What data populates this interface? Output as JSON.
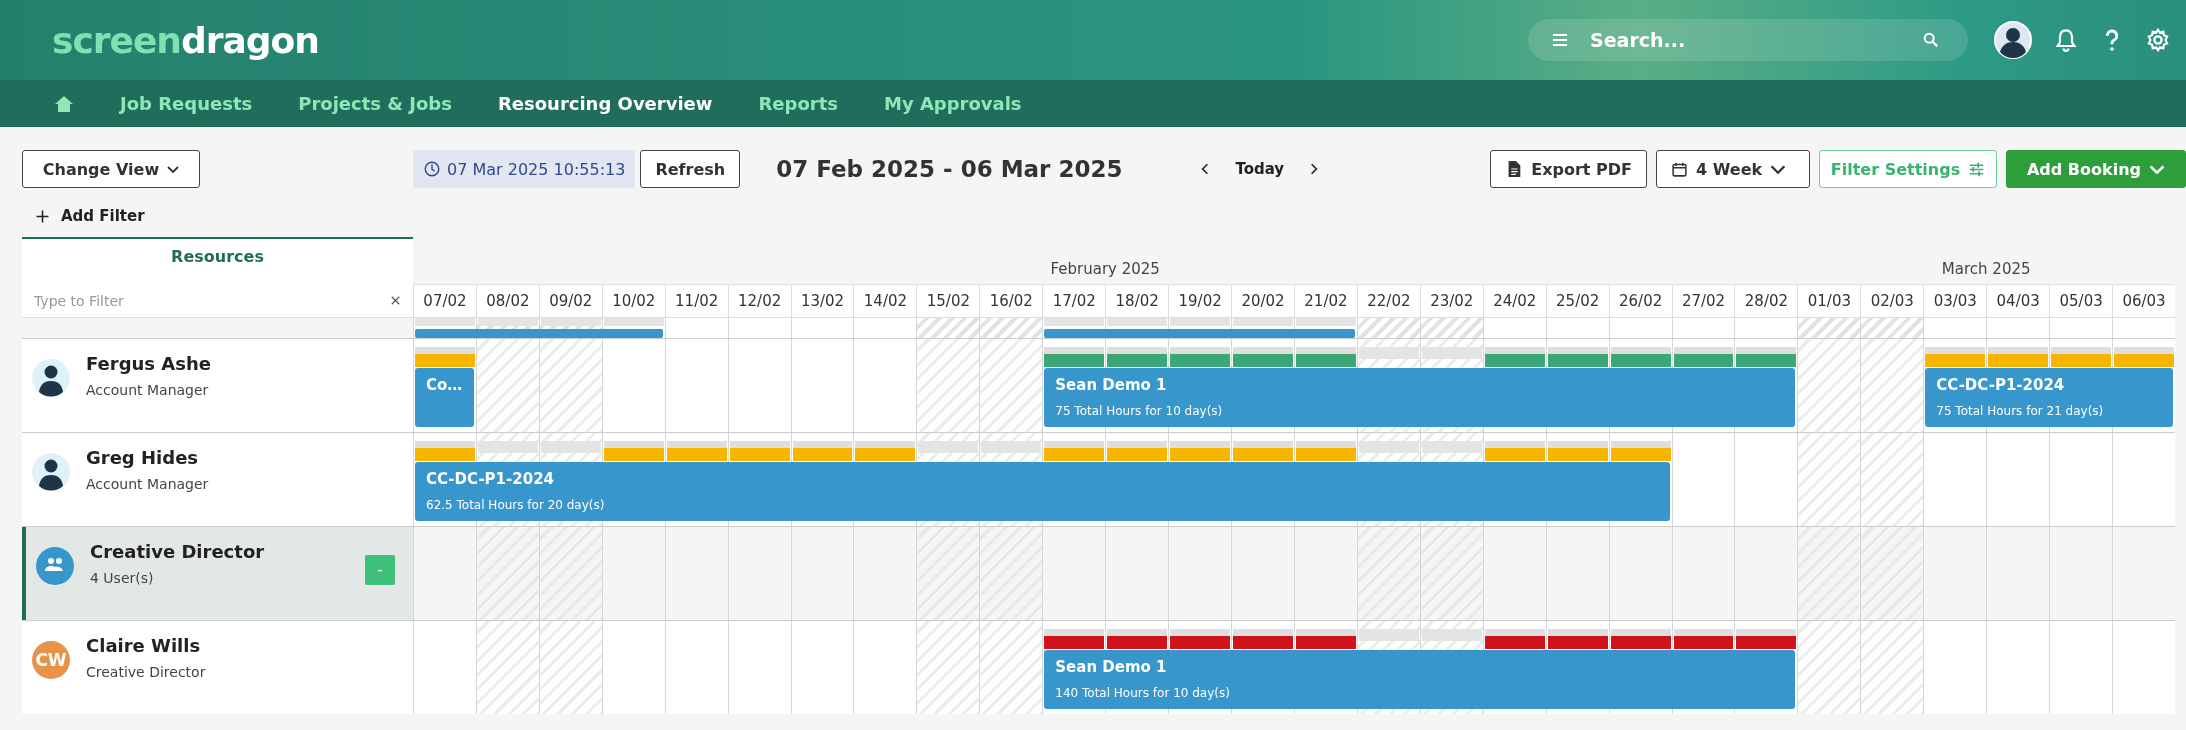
{
  "header": {
    "logo": {
      "light": "screen",
      "bold": "dragon"
    },
    "search": {
      "placeholder": "Search..."
    }
  },
  "nav": {
    "items": [
      {
        "kind": "home",
        "selected": false
      },
      {
        "label": "Job Requests",
        "selected": false
      },
      {
        "label": "Projects & Jobs",
        "selected": false
      },
      {
        "label": "Resourcing Overview",
        "selected": true
      },
      {
        "label": "Reports",
        "selected": false
      },
      {
        "label": "My Approvals",
        "selected": false
      }
    ]
  },
  "toolbar": {
    "change_view": "Change View",
    "timestamp": "07 Mar 2025 10:55:13",
    "refresh": "Refresh",
    "range": "07 Feb 2025 - 06 Mar 2025",
    "today": "Today",
    "export": "Export PDF",
    "period": "4 Week",
    "filter_settings": "Filter Settings",
    "add_booking": "Add Booking",
    "add_filter": "Add Filter"
  },
  "resources": {
    "title": "Resources",
    "filter_placeholder": "Type to Filter"
  },
  "months": [
    {
      "label": "February 2025",
      "days": [
        {
          "label": "07/02",
          "weekend": false
        },
        {
          "label": "08/02",
          "weekend": true
        },
        {
          "label": "09/02",
          "weekend": true
        },
        {
          "label": "10/02",
          "weekend": false
        },
        {
          "label": "11/02",
          "weekend": false
        },
        {
          "label": "12/02",
          "weekend": false
        },
        {
          "label": "13/02",
          "weekend": false
        },
        {
          "label": "14/02",
          "weekend": false
        },
        {
          "label": "15/02",
          "weekend": true
        },
        {
          "label": "16/02",
          "weekend": true
        },
        {
          "label": "17/02",
          "weekend": false
        },
        {
          "label": "18/02",
          "weekend": false
        },
        {
          "label": "19/02",
          "weekend": false
        },
        {
          "label": "20/02",
          "weekend": false
        },
        {
          "label": "21/02",
          "weekend": false
        },
        {
          "label": "22/02",
          "weekend": true
        },
        {
          "label": "23/02",
          "weekend": true
        },
        {
          "label": "24/02",
          "weekend": false
        },
        {
          "label": "25/02",
          "weekend": false
        },
        {
          "label": "26/02",
          "weekend": false
        },
        {
          "label": "27/02",
          "weekend": false
        },
        {
          "label": "28/02",
          "weekend": false
        }
      ]
    },
    {
      "label": "March 2025",
      "days": [
        {
          "label": "01/03",
          "weekend": true
        },
        {
          "label": "02/03",
          "weekend": true
        },
        {
          "label": "03/03",
          "weekend": false
        },
        {
          "label": "04/03",
          "weekend": false
        },
        {
          "label": "05/03",
          "weekend": false
        },
        {
          "label": "06/03",
          "weekend": false
        }
      ]
    }
  ],
  "cut_row": {
    "slots": [
      {
        "kind": "booking",
        "days": [
          {
            "kind": "none"
          },
          {
            "kind": "none"
          },
          {
            "kind": "none"
          },
          {
            "kind": "none"
          }
        ]
      },
      {
        "kind": "free"
      },
      {
        "kind": "free"
      },
      {
        "kind": "free"
      },
      {
        "kind": "free"
      },
      {
        "kind": "free"
      },
      {
        "kind": "free"
      },
      {
        "kind": "booking",
        "days": [
          {
            "kind": "none"
          },
          {
            "kind": "none"
          },
          {
            "kind": "none"
          },
          {
            "kind": "none"
          },
          {
            "kind": "none"
          }
        ]
      },
      {
        "kind": "free"
      },
      {
        "kind": "free"
      },
      {
        "kind": "free"
      },
      {
        "kind": "free"
      },
      {
        "kind": "free"
      },
      {
        "kind": "free"
      },
      {
        "kind": "free"
      },
      {
        "kind": "free"
      },
      {
        "kind": "free"
      },
      {
        "kind": "free"
      },
      {
        "kind": "free"
      },
      {
        "kind": "free"
      },
      {
        "kind": "free"
      }
    ]
  },
  "rows": [
    {
      "kind": "person",
      "name": "Fergus Ashe",
      "role": "Account Manager",
      "avatar": {
        "kind": "silhouette"
      },
      "slots": [
        {
          "kind": "booking",
          "title": "Co…",
          "days": [
            {
              "kind": "load",
              "color": "#f7b500"
            }
          ]
        },
        {
          "kind": "free"
        },
        {
          "kind": "free"
        },
        {
          "kind": "free"
        },
        {
          "kind": "free"
        },
        {
          "kind": "free"
        },
        {
          "kind": "free"
        },
        {
          "kind": "free"
        },
        {
          "kind": "free"
        },
        {
          "kind": "free"
        },
        {
          "kind": "booking",
          "title": "Sean Demo 1",
          "hours": "75 Total Hours for 10 day(s)",
          "days": [
            {
              "kind": "load",
              "color": "#3aa874"
            },
            {
              "kind": "load",
              "color": "#3aa874"
            },
            {
              "kind": "load",
              "color": "#3aa874"
            },
            {
              "kind": "load",
              "color": "#3aa874"
            },
            {
              "kind": "load",
              "color": "#3aa874"
            },
            {
              "kind": "none"
            },
            {
              "kind": "none"
            },
            {
              "kind": "load",
              "color": "#3aa874"
            },
            {
              "kind": "load",
              "color": "#3aa874"
            },
            {
              "kind": "load",
              "color": "#3aa874"
            },
            {
              "kind": "load",
              "color": "#3aa874"
            },
            {
              "kind": "load",
              "color": "#3aa874"
            }
          ]
        },
        {
          "kind": "free"
        },
        {
          "kind": "free"
        },
        {
          "kind": "booking",
          "title": "CC-DC-P1-2024",
          "hours": "75 Total Hours for 21 day(s)",
          "days": [
            {
              "kind": "load",
              "color": "#f7b500"
            },
            {
              "kind": "load",
              "color": "#f7b500"
            },
            {
              "kind": "load",
              "color": "#f7b500"
            },
            {
              "kind": "load",
              "color": "#f7b500"
            }
          ]
        }
      ]
    },
    {
      "kind": "person",
      "name": "Greg Hides",
      "role": "Account Manager",
      "avatar": {
        "kind": "silhouette"
      },
      "slots": [
        {
          "kind": "booking",
          "title": "CC-DC-P1-2024",
          "hours": "62.5 Total Hours for 20 day(s)",
          "days": [
            {
              "kind": "load",
              "color": "#f7b500"
            },
            {
              "kind": "none"
            },
            {
              "kind": "none"
            },
            {
              "kind": "load",
              "color": "#f7b500"
            },
            {
              "kind": "load",
              "color": "#f7b500"
            },
            {
              "kind": "load",
              "color": "#f7b500"
            },
            {
              "kind": "load",
              "color": "#f7b500"
            },
            {
              "kind": "load",
              "color": "#f7b500"
            },
            {
              "kind": "none"
            },
            {
              "kind": "none"
            },
            {
              "kind": "load",
              "color": "#f7b500"
            },
            {
              "kind": "load",
              "color": "#f7b500"
            },
            {
              "kind": "load",
              "color": "#f7b500"
            },
            {
              "kind": "load",
              "color": "#f7b500"
            },
            {
              "kind": "load",
              "color": "#f7b500"
            },
            {
              "kind": "none"
            },
            {
              "kind": "none"
            },
            {
              "kind": "load",
              "color": "#f7b500"
            },
            {
              "kind": "load",
              "color": "#f7b500"
            },
            {
              "kind": "load",
              "color": "#f7b500"
            }
          ]
        },
        {
          "kind": "free"
        },
        {
          "kind": "free"
        },
        {
          "kind": "free"
        },
        {
          "kind": "free"
        },
        {
          "kind": "free"
        },
        {
          "kind": "free"
        },
        {
          "kind": "free"
        },
        {
          "kind": "free"
        }
      ]
    },
    {
      "kind": "group",
      "name": "Creative Director",
      "role": "4 User(s)",
      "toggle": "-",
      "expanded": true
    },
    {
      "kind": "person",
      "name": "Claire Wills",
      "role": "Creative Director",
      "avatar": {
        "kind": "initials",
        "text": "CW",
        "color": "#e8924a"
      },
      "slots": [
        {
          "kind": "free"
        },
        {
          "kind": "free"
        },
        {
          "kind": "free"
        },
        {
          "kind": "free"
        },
        {
          "kind": "free"
        },
        {
          "kind": "free"
        },
        {
          "kind": "free"
        },
        {
          "kind": "free"
        },
        {
          "kind": "free"
        },
        {
          "kind": "free"
        },
        {
          "kind": "booking",
          "title": "Sean Demo 1",
          "hours": "140 Total Hours for 10 day(s)",
          "days": [
            {
              "kind": "load",
              "color": "#d0121a"
            },
            {
              "kind": "load",
              "color": "#d0121a"
            },
            {
              "kind": "load",
              "color": "#d0121a"
            },
            {
              "kind": "load",
              "color": "#d0121a"
            },
            {
              "kind": "load",
              "color": "#d0121a"
            },
            {
              "kind": "none"
            },
            {
              "kind": "none"
            },
            {
              "kind": "load",
              "color": "#d0121a"
            },
            {
              "kind": "load",
              "color": "#d0121a"
            },
            {
              "kind": "load",
              "color": "#d0121a"
            },
            {
              "kind": "load",
              "color": "#d0121a"
            },
            {
              "kind": "load",
              "color": "#d0121a"
            }
          ]
        },
        {
          "kind": "free"
        },
        {
          "kind": "free"
        },
        {
          "kind": "free"
        },
        {
          "kind": "free"
        },
        {
          "kind": "free"
        },
        {
          "kind": "free"
        }
      ]
    }
  ]
}
